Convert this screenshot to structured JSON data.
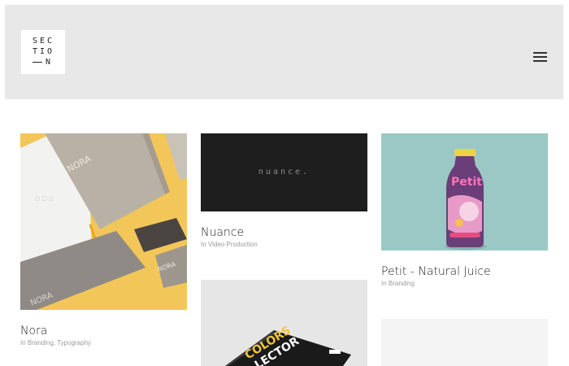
{
  "colors": {
    "header_bg": "#e8e8e8",
    "nora_bg": "#f3c65a",
    "nuance_bg": "#1e1e1e",
    "petit_bg": "#9bc8c4",
    "colors_bg": "#e6e6e6",
    "empty_bg": "#f4f4f4"
  },
  "header": {
    "logo_lines": [
      "SEC",
      "TIO",
      "N"
    ],
    "menu_icon": "hamburger-menu-icon"
  },
  "projects": [
    {
      "title": "Nora",
      "meta": "In Branding, Typography",
      "image_text": "NORA"
    },
    {
      "title": "Nuance",
      "meta": "In Video Production",
      "image_text": "nuance."
    },
    {
      "title": "Petit - Natural Juice",
      "meta": "In Branding",
      "image_text": "Petit"
    },
    {
      "image_text_1": "COLORS",
      "image_text_2": "LECTOR"
    }
  ]
}
